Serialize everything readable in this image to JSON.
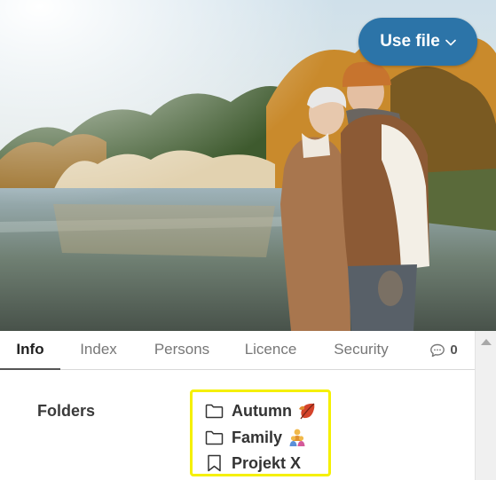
{
  "toolbar": {
    "use_file_label": "Use file"
  },
  "tabs": [
    {
      "label": "Info",
      "active": true
    },
    {
      "label": "Index",
      "active": false
    },
    {
      "label": "Persons",
      "active": false
    },
    {
      "label": "Licence",
      "active": false
    },
    {
      "label": "Security",
      "active": false
    },
    {
      "label": "0",
      "icon": "comment-icon",
      "active": false
    }
  ],
  "info": {
    "folders_label": "Folders",
    "folders": [
      {
        "name": "Autumn",
        "icon": "folder-icon",
        "emoji": "fallen-leaf-icon"
      },
      {
        "name": "Family",
        "icon": "folder-icon",
        "emoji": "family-icon"
      },
      {
        "name": "Projekt X",
        "icon": "bookmark-icon"
      }
    ]
  },
  "colors": {
    "accent_button": "#2c74a8",
    "highlight_border": "#f5f000",
    "active_tab_text": "#1f1f1f",
    "inactive_tab_text": "#777777"
  }
}
